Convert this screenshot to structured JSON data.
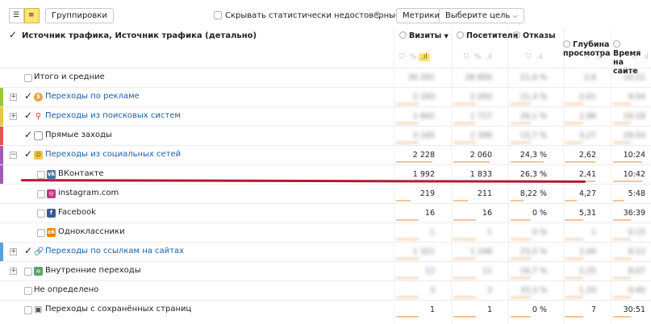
{
  "toolbar": {
    "groupings_label": "Группировки",
    "hide_stats_label": "Скрывать статистически недостоверные данн...",
    "metrics_label": "Метрики",
    "select_goal_label": "Выберите цель"
  },
  "header": {
    "dimension_title": "Источник трафика, Источник трафика (детально)",
    "columns": [
      {
        "label": "Визиты",
        "sort": "▼"
      },
      {
        "label": "Посетители"
      },
      {
        "label": "Отказы"
      },
      {
        "label": "Глубина\nпросмотра"
      },
      {
        "label": "Время\nна сайте"
      }
    ],
    "filter_icons": [
      "⛉",
      "%",
      ".ıl"
    ]
  },
  "rows": [
    {
      "label": "Итого и средние",
      "values": [
        "30 291",
        "28 850",
        "21,4 %",
        "2,6",
        "10:21"
      ],
      "blur": true
    },
    {
      "label": "Переходы по рекламе",
      "values": [
        "2 183",
        "2 093",
        "21,3 %",
        "2,01",
        "9:54"
      ],
      "blur": true
    },
    {
      "label": "Переходы из поисковых систем",
      "values": [
        "1 842",
        "1 717",
        "26,1 %",
        "1,96",
        "10:18"
      ],
      "blur": true
    },
    {
      "label": "Прямые заходы",
      "values": [
        "3 165",
        "2 399",
        "15,7 %",
        "3,27",
        "29:54"
      ],
      "blur": true
    },
    {
      "label": "Переходы из социальных сетей",
      "values": [
        "2 228",
        "2 060",
        "24,3 %",
        "2,62",
        "10:24"
      ],
      "blur": false
    },
    {
      "label": "ВКонтакте",
      "values": [
        "1 992",
        "1 833",
        "26,3 %",
        "2,41",
        "10:42"
      ],
      "blur": false
    },
    {
      "label": "instagram.com",
      "values": [
        "219",
        "211",
        "8,22 %",
        "4,27",
        "5:48"
      ],
      "blur": false
    },
    {
      "label": "Facebook",
      "values": [
        "16",
        "16",
        "0 %",
        "5,31",
        "36:39"
      ],
      "blur": false
    },
    {
      "label": "Одноклассники",
      "values": [
        "1",
        "1",
        "0 %",
        "1",
        "0:15"
      ],
      "blur": true
    },
    {
      "label": "Переходы по ссылкам на сайтах",
      "values": [
        "1 321",
        "1 248",
        "23,5 %",
        "2,44",
        "9:12"
      ],
      "blur": true
    },
    {
      "label": "Внутренние переходы",
      "values": [
        "12",
        "11",
        "16,7 %",
        "2,25",
        "8:07"
      ],
      "blur": true
    },
    {
      "label": "Не определено",
      "values": [
        "3",
        "3",
        "33,3 %",
        "1,33",
        "0:40"
      ],
      "blur": true
    },
    {
      "label": "Переходы с сохранённых страниц",
      "values": [
        "1",
        "1",
        "0 %",
        "7",
        "30:51"
      ],
      "blur": false
    }
  ],
  "colors": {
    "ads": "#9bc53d",
    "search": "#e8c547",
    "direct": "#e2574c",
    "social": "#a35ab8",
    "links": "#5aa0d8",
    "accent_yellow": "#ffe476",
    "annotation_red": "#b01a36"
  }
}
